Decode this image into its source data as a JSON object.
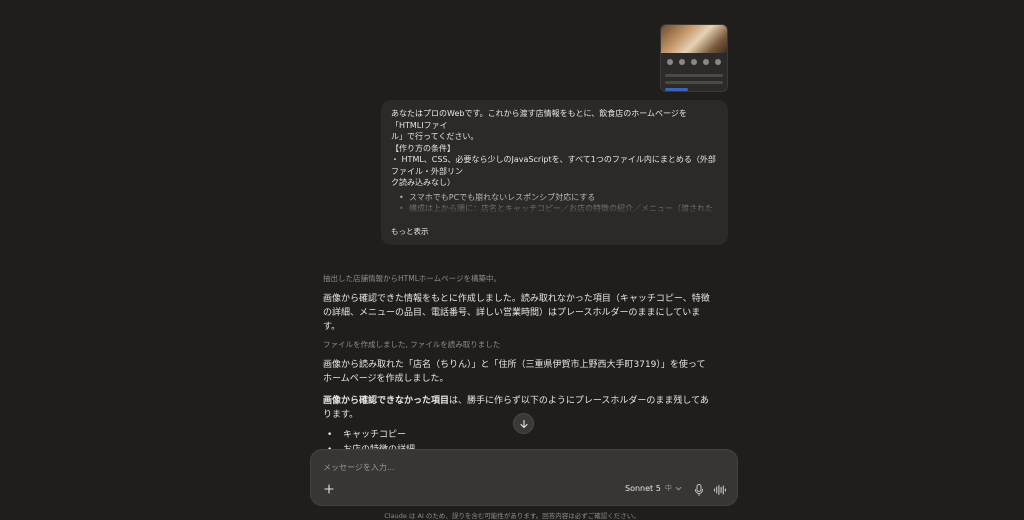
{
  "user_message": {
    "intro_lines": [
      "あなたはプロのWebです。これから渡す店情報をもとに、飲食店のホームページを「HTMLIファイ",
      "ル」で行ってください。",
      "【作り方の条件】",
      "・ HTML、CSS、必要なら少しのJavaScriptを、すべて1つのファイル内にまとめる（外部ファイル・外部リン",
      "ク読み込みなし）"
    ],
    "bullets": [
      "スマホでもPCでも崩れないレスポンシブ対応にする",
      "構成は上から順に：店名とキャッチコピー／お店の特徴の紹介／メニュー（渡された範囲のみ）／アクセス"
    ],
    "show_more": "もっと表示"
  },
  "assistant": {
    "status_1": "抽出した店舗情報からHTMLホームページを構築中。",
    "para_1": "画像から確認できた情報をもとに作成しました。読み取れなかった項目（キャッチコピー、特徴の詳細、メニューの品目、電話番号、詳しい営業時間）はプレースホルダーのままにしています。",
    "status_2": "ファイルを作成しました, ファイルを読み取りました",
    "para_2": "画像から読み取れた「店名（ちりん）」と「住所（三重県伊賀市上野西大手町3719）」を使ってホームページを作成しました。",
    "para_3_bold": "画像から確認できなかった項目",
    "para_3_rest": "は、勝手に作らず以下のようにプレースホルダーのまま残してあります。",
    "bullets": [
      "キャッチコピー",
      "お店の特徴の詳細"
    ]
  },
  "composer": {
    "placeholder": "メッセージを入力...",
    "model_name": "Sonnet 5",
    "model_level": "中"
  },
  "footer": "Claude は AI のため、誤りを含む可能性があります。回答内容は必ずご確認ください。",
  "icons": {
    "thumbnail": "attached-image-thumbnail",
    "scroll": "arrow-down-icon",
    "add": "plus-icon",
    "chevron": "chevron-down-icon",
    "mic": "microphone-icon",
    "voice": "voice-waveform-icon"
  }
}
